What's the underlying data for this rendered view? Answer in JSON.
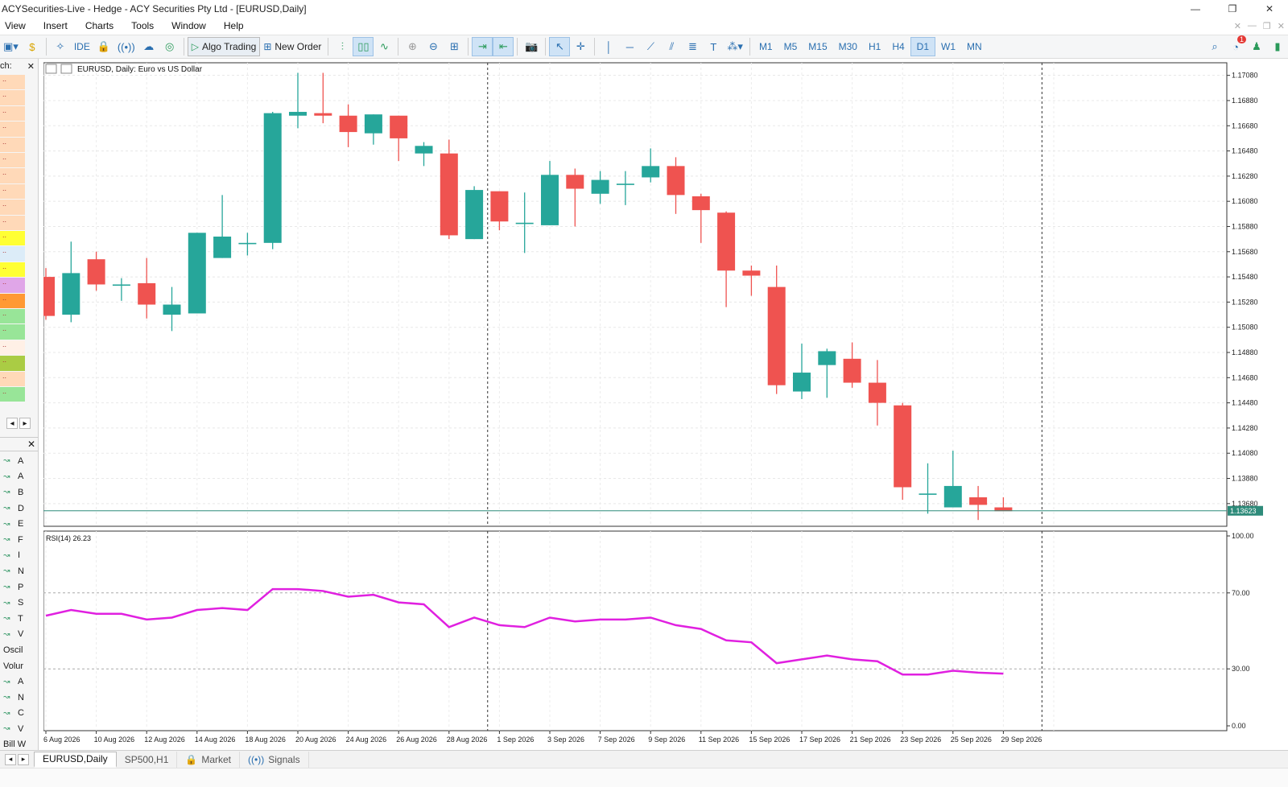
{
  "window": {
    "title": "ACYSecurities-Live - Hedge - ACY Securities Pty Ltd - [EURUSD,Daily]",
    "min_glyph": "—",
    "restore_glyph": "❐",
    "close_glyph": "✕"
  },
  "menu": [
    {
      "label": "View"
    },
    {
      "label": "Insert"
    },
    {
      "label": "Charts"
    },
    {
      "label": "Tools"
    },
    {
      "label": "Window"
    },
    {
      "label": "Help"
    }
  ],
  "toolbar": {
    "ide_label": "IDE",
    "algo_label": "Algo Trading",
    "new_order_label": "New Order",
    "timeframes": [
      "M1",
      "M5",
      "M15",
      "M30",
      "H1",
      "H4",
      "D1",
      "W1",
      "MN"
    ],
    "active_timeframe": "D1",
    "notification_count": "1"
  },
  "left_panel": {
    "top_label": "ch:",
    "nav_items": [
      "A",
      "A",
      "B",
      "D",
      "E",
      "F",
      "I",
      "N",
      "P",
      "S",
      "T",
      "V",
      "Oscil",
      "Volur",
      "A",
      "N",
      "C",
      "V",
      "Bill W"
    ],
    "strip_colors": [
      "#ffd9b8",
      "#ffd9b8",
      "#ffd9b8",
      "#ffd9b8",
      "#ffd9b8",
      "#ffd9b8",
      "#ffd9b8",
      "#ffd9b8",
      "#ffd9b8",
      "#ffd9b8",
      "#ffff33",
      "#dcecf8",
      "#ffff33",
      "#e0a6e8",
      "#ff9933",
      "#98e598",
      "#98e598",
      "#fff0e6",
      "#aacc44",
      "#ffd9b8",
      "#98e598"
    ]
  },
  "chart": {
    "header_label": "EURUSD, Daily:  Euro vs US Dollar",
    "current_price_label": "1.13623",
    "rsi_label": "RSI(14) 26.23"
  },
  "chart_data": {
    "type": "candlestick",
    "symbol": "EURUSD",
    "timeframe": "Daily",
    "price_ylim": [
      1.135,
      1.1718
    ],
    "price_ticks": [
      "1.17080",
      "1.16880",
      "1.16680",
      "1.16480",
      "1.16280",
      "1.16080",
      "1.15880",
      "1.15680",
      "1.15480",
      "1.15280",
      "1.15080",
      "1.14880",
      "1.14680",
      "1.14480",
      "1.14280",
      "1.14080",
      "1.13880",
      "1.13680"
    ],
    "current_price": 1.13623,
    "x_labels": [
      "6 Aug 2026",
      "10 Aug 2026",
      "12 Aug 2026",
      "14 Aug 2026",
      "18 Aug 2026",
      "20 Aug 2026",
      "24 Aug 2026",
      "26 Aug 2026",
      "28 Aug 2026",
      "1 Sep 2026",
      "3 Sep 2026",
      "7 Sep 2026",
      "9 Sep 2026",
      "11 Sep 2026",
      "15 Sep 2026",
      "17 Sep 2026",
      "21 Sep 2026",
      "23 Sep 2026",
      "25 Sep 2026",
      "29 Sep 2026"
    ],
    "candles": [
      {
        "o": 1.1548,
        "h": 1.1555,
        "l": 1.1514,
        "c": 1.1517
      },
      {
        "o": 1.1518,
        "h": 1.1576,
        "l": 1.1512,
        "c": 1.1551
      },
      {
        "o": 1.1562,
        "h": 1.1568,
        "l": 1.1537,
        "c": 1.1542
      },
      {
        "o": 1.1542,
        "h": 1.1547,
        "l": 1.1529,
        "c": 1.1542
      },
      {
        "o": 1.1543,
        "h": 1.1563,
        "l": 1.1515,
        "c": 1.1526
      },
      {
        "o": 1.1518,
        "h": 1.154,
        "l": 1.1505,
        "c": 1.1526
      },
      {
        "o": 1.1519,
        "h": 1.1583,
        "l": 1.1519,
        "c": 1.1583
      },
      {
        "o": 1.1563,
        "h": 1.1613,
        "l": 1.1563,
        "c": 1.158
      },
      {
        "o": 1.1575,
        "h": 1.1583,
        "l": 1.1565,
        "c": 1.1575
      },
      {
        "o": 1.1575,
        "h": 1.1679,
        "l": 1.157,
        "c": 1.1678
      },
      {
        "o": 1.1676,
        "h": 1.171,
        "l": 1.1666,
        "c": 1.1679
      },
      {
        "o": 1.1678,
        "h": 1.171,
        "l": 1.167,
        "c": 1.1676
      },
      {
        "o": 1.1676,
        "h": 1.1685,
        "l": 1.1651,
        "c": 1.1663
      },
      {
        "o": 1.1662,
        "h": 1.1677,
        "l": 1.1653,
        "c": 1.1677
      },
      {
        "o": 1.1676,
        "h": 1.1676,
        "l": 1.164,
        "c": 1.1658
      },
      {
        "o": 1.1646,
        "h": 1.1655,
        "l": 1.1636,
        "c": 1.1652
      },
      {
        "o": 1.1646,
        "h": 1.1657,
        "l": 1.1578,
        "c": 1.1581
      },
      {
        "o": 1.1578,
        "h": 1.162,
        "l": 1.1578,
        "c": 1.1617
      },
      {
        "o": 1.1616,
        "h": 1.1616,
        "l": 1.1585,
        "c": 1.1592
      },
      {
        "o": 1.1591,
        "h": 1.1615,
        "l": 1.1567,
        "c": 1.1591
      },
      {
        "o": 1.1589,
        "h": 1.164,
        "l": 1.1589,
        "c": 1.1629
      },
      {
        "o": 1.1629,
        "h": 1.1634,
        "l": 1.1588,
        "c": 1.1618
      },
      {
        "o": 1.1614,
        "h": 1.1632,
        "l": 1.1606,
        "c": 1.1625
      },
      {
        "o": 1.1621,
        "h": 1.1632,
        "l": 1.1605,
        "c": 1.1622
      },
      {
        "o": 1.1627,
        "h": 1.165,
        "l": 1.1623,
        "c": 1.1636
      },
      {
        "o": 1.1636,
        "h": 1.1643,
        "l": 1.1598,
        "c": 1.1613
      },
      {
        "o": 1.1612,
        "h": 1.1614,
        "l": 1.1575,
        "c": 1.1601
      },
      {
        "o": 1.1599,
        "h": 1.16,
        "l": 1.1524,
        "c": 1.1553
      },
      {
        "o": 1.1553,
        "h": 1.1557,
        "l": 1.1533,
        "c": 1.1549
      },
      {
        "o": 1.154,
        "h": 1.1557,
        "l": 1.1455,
        "c": 1.1462
      },
      {
        "o": 1.1457,
        "h": 1.1495,
        "l": 1.1451,
        "c": 1.1472
      },
      {
        "o": 1.1478,
        "h": 1.1491,
        "l": 1.1452,
        "c": 1.1489
      },
      {
        "o": 1.1483,
        "h": 1.1496,
        "l": 1.146,
        "c": 1.1464
      },
      {
        "o": 1.1464,
        "h": 1.1482,
        "l": 1.143,
        "c": 1.1448
      },
      {
        "o": 1.1446,
        "h": 1.1448,
        "l": 1.1371,
        "c": 1.1381
      },
      {
        "o": 1.1376,
        "h": 1.14,
        "l": 1.136,
        "c": 1.1376
      },
      {
        "o": 1.1365,
        "h": 1.141,
        "l": 1.1365,
        "c": 1.1382
      },
      {
        "o": 1.1373,
        "h": 1.1382,
        "l": 1.1355,
        "c": 1.1367
      },
      {
        "o": 1.1365,
        "h": 1.1373,
        "l": 1.1362,
        "c": 1.1362
      }
    ],
    "rsi": {
      "label": "RSI(14)",
      "ylim": [
        0,
        100
      ],
      "levels": [
        30,
        70
      ],
      "tick_labels": [
        "100.00",
        "70.00",
        "30.00",
        "0.00"
      ],
      "values": [
        58,
        61,
        59,
        59,
        56,
        57,
        61,
        62,
        61,
        72,
        72,
        71,
        68,
        69,
        65,
        64,
        52,
        57,
        53,
        52,
        57,
        55,
        56,
        56,
        57,
        53,
        51,
        45,
        44,
        33,
        35,
        37,
        35,
        34,
        27,
        27,
        29,
        28,
        27.5
      ]
    },
    "colors": {
      "bull": "#26a69a",
      "bear": "#ef5350",
      "rsi": "#e020e0",
      "price_line": "#2e8b7a"
    },
    "grid": true
  },
  "bottom_tabs": [
    {
      "label": "EURUSD,Daily",
      "active": true
    },
    {
      "label": "SP500,H1",
      "active": false
    },
    {
      "label": "Market",
      "active": false
    },
    {
      "label": "Signals",
      "active": false
    }
  ]
}
